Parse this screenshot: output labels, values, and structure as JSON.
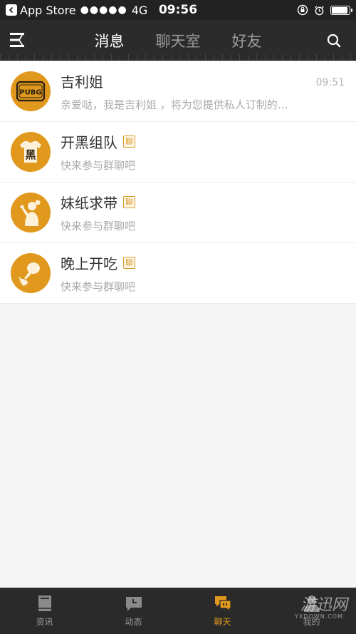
{
  "status_bar": {
    "carrier": "App Store",
    "signal": "●●●●●",
    "network": "4G",
    "time": "09:56",
    "battery_level": 0.9
  },
  "nav": {
    "tabs": [
      {
        "label": "消息",
        "active": true
      },
      {
        "label": "聊天室",
        "active": false
      },
      {
        "label": "好友",
        "active": false
      }
    ]
  },
  "conversations": [
    {
      "title": "吉利姐",
      "preview": "亲爱哒，我是吉利姐 ，将为您提供私人订制的…",
      "time": "09:51",
      "avatar_icon": "pubg-badge-icon",
      "avatar_text": "PUBG"
    },
    {
      "title": "开黑组队",
      "tag": "聊",
      "preview": "快来参与群聊吧",
      "avatar_icon": "hei-shirt-icon",
      "avatar_text": "黑"
    },
    {
      "title": "妹纸求带",
      "tag": "聊",
      "preview": "快来参与群聊吧",
      "avatar_icon": "girl-icon"
    },
    {
      "title": "晚上开吃",
      "tag": "聊",
      "preview": "快来参与群聊吧",
      "avatar_icon": "drumstick-icon"
    }
  ],
  "tab_bar": {
    "items": [
      {
        "label": "资讯",
        "icon": "book-icon",
        "active": false
      },
      {
        "label": "动态",
        "icon": "clock-bubble-icon",
        "active": false
      },
      {
        "label": "聊天",
        "icon": "chat-icon",
        "active": true
      },
      {
        "label": "我的",
        "icon": "person-icon",
        "active": false
      }
    ]
  },
  "watermark": {
    "text": "游迅网",
    "sub": "YXDOWN.COM"
  },
  "colors": {
    "accent": "#e0991d",
    "nav_bg": "#2b2b2b",
    "tab_bar_bg": "#2a2a2a"
  }
}
